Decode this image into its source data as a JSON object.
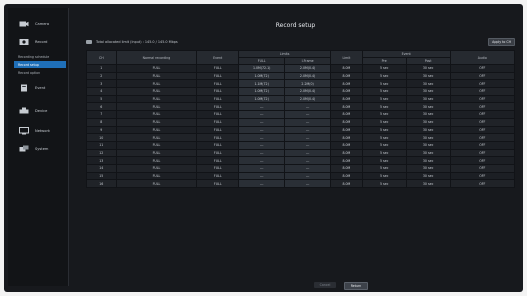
{
  "sidebar": {
    "items": [
      {
        "label": "Camera",
        "icon": "camera-icon"
      },
      {
        "label": "Record",
        "icon": "record-icon"
      },
      {
        "label": "Event",
        "icon": "event-icon"
      },
      {
        "label": "Device",
        "icon": "device-icon"
      },
      {
        "label": "Network",
        "icon": "network-icon"
      },
      {
        "label": "System",
        "icon": "system-icon"
      }
    ],
    "subitems": [
      "Recording schedule",
      "Record setup",
      "Record option"
    ]
  },
  "title": "Record setup",
  "total": "Total allocated limit (Input) : 145.0 / 145.0 Mbps",
  "apply_label": "Apply to CH",
  "columns": {
    "ch": "CH",
    "normal": "Normal recording",
    "event": "Event",
    "limits": "Limits",
    "full": "FULL",
    "iframe": "I-Frame",
    "limit": "Limit",
    "event_time": "Event",
    "pre": "Pre",
    "post": "Post",
    "audio": "Audio"
  },
  "rows": [
    {
      "ch": "1",
      "normal": "FULL",
      "event": "FULL",
      "full": "1.0M(72.1)",
      "iframe": "2.0M(0.4)",
      "limit": "8.0M",
      "pre": "5 sec",
      "post": "30 sec",
      "audio": "OFF"
    },
    {
      "ch": "2",
      "normal": "FULL",
      "event": "FULL",
      "full": "1.0M(72)",
      "iframe": "2.0M(0.4)",
      "limit": "8.0M",
      "pre": "5 sec",
      "post": "30 sec",
      "audio": "OFF"
    },
    {
      "ch": "3",
      "normal": "FULL",
      "event": "FULL",
      "full": "1.1M(72)",
      "iframe": "2.2M(0)",
      "limit": "8.0M",
      "pre": "5 sec",
      "post": "30 sec",
      "audio": "OFF"
    },
    {
      "ch": "4",
      "normal": "FULL",
      "event": "FULL",
      "full": "1.0M(72)",
      "iframe": "2.0M(0.4)",
      "limit": "8.0M",
      "pre": "5 sec",
      "post": "30 sec",
      "audio": "OFF"
    },
    {
      "ch": "5",
      "normal": "FULL",
      "event": "FULL",
      "full": "1.0M(72)",
      "iframe": "2.0M(0.4)",
      "limit": "8.0M",
      "pre": "5 sec",
      "post": "30 sec",
      "audio": "OFF"
    },
    {
      "ch": "6",
      "normal": "FULL",
      "event": "FULL",
      "full": "---",
      "iframe": "---",
      "limit": "8.0M",
      "pre": "5 sec",
      "post": "30 sec",
      "audio": "OFF"
    },
    {
      "ch": "7",
      "normal": "FULL",
      "event": "FULL",
      "full": "---",
      "iframe": "---",
      "limit": "8.0M",
      "pre": "5 sec",
      "post": "30 sec",
      "audio": "OFF"
    },
    {
      "ch": "8",
      "normal": "FULL",
      "event": "FULL",
      "full": "---",
      "iframe": "---",
      "limit": "8.0M",
      "pre": "5 sec",
      "post": "30 sec",
      "audio": "OFF"
    },
    {
      "ch": "9",
      "normal": "FULL",
      "event": "FULL",
      "full": "---",
      "iframe": "---",
      "limit": "8.0M",
      "pre": "5 sec",
      "post": "30 sec",
      "audio": "OFF"
    },
    {
      "ch": "10",
      "normal": "FULL",
      "event": "FULL",
      "full": "---",
      "iframe": "---",
      "limit": "8.0M",
      "pre": "5 sec",
      "post": "30 sec",
      "audio": "OFF"
    },
    {
      "ch": "11",
      "normal": "FULL",
      "event": "FULL",
      "full": "---",
      "iframe": "---",
      "limit": "8.0M",
      "pre": "5 sec",
      "post": "30 sec",
      "audio": "OFF"
    },
    {
      "ch": "12",
      "normal": "FULL",
      "event": "FULL",
      "full": "---",
      "iframe": "---",
      "limit": "8.0M",
      "pre": "5 sec",
      "post": "30 sec",
      "audio": "OFF"
    },
    {
      "ch": "13",
      "normal": "FULL",
      "event": "FULL",
      "full": "---",
      "iframe": "---",
      "limit": "8.0M",
      "pre": "5 sec",
      "post": "30 sec",
      "audio": "OFF"
    },
    {
      "ch": "14",
      "normal": "FULL",
      "event": "FULL",
      "full": "---",
      "iframe": "---",
      "limit": "8.0M",
      "pre": "5 sec",
      "post": "30 sec",
      "audio": "OFF"
    },
    {
      "ch": "15",
      "normal": "FULL",
      "event": "FULL",
      "full": "---",
      "iframe": "---",
      "limit": "8.0M",
      "pre": "5 sec",
      "post": "30 sec",
      "audio": "OFF"
    },
    {
      "ch": "16",
      "normal": "FULL",
      "event": "FULL",
      "full": "---",
      "iframe": "---",
      "limit": "8.0M",
      "pre": "5 sec",
      "post": "30 sec",
      "audio": "OFF"
    }
  ],
  "buttons": {
    "cancel": "Cancel",
    "ok": "Return"
  },
  "colors": {
    "accent": "#1f6fb8",
    "background": "#17191d"
  }
}
